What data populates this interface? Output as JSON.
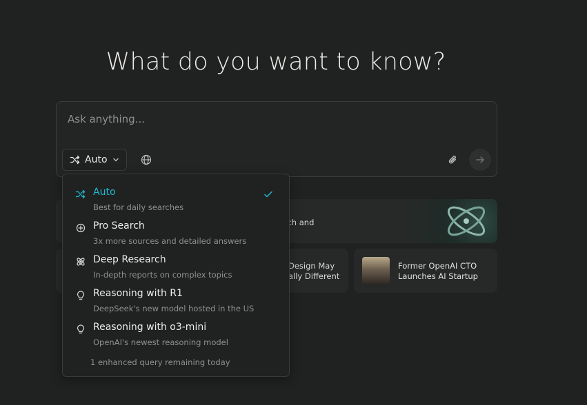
{
  "heading": "What do you want to know?",
  "search": {
    "placeholder": "Ask anything...",
    "mode_label": "Auto"
  },
  "cards": {
    "wide_text": "rch and",
    "middle_line1": "Design May",
    "middle_line2": "ally Different",
    "right_line1": "Former OpenAI CTO",
    "right_line2": "Launches AI Startup"
  },
  "dropdown": {
    "options": [
      {
        "label": "Auto",
        "desc": "Best for daily searches",
        "selected": true,
        "icon": "shuffle-icon"
      },
      {
        "label": "Pro Search",
        "desc": "3x more sources and detailed answers",
        "icon": "pro-search-icon"
      },
      {
        "label": "Deep Research",
        "desc": "In-depth reports on complex topics",
        "icon": "atom-icon"
      },
      {
        "label": "Reasoning with R1",
        "desc": "DeepSeek's new model hosted in the US",
        "icon": "lightbulb-icon"
      },
      {
        "label": "Reasoning with o3-mini",
        "desc": "OpenAI's newest reasoning model",
        "icon": "lightbulb-icon"
      }
    ],
    "footer": "1 enhanced query remaining today"
  },
  "colors": {
    "background": "#202121",
    "accent": "#20b8cd",
    "border": "#3a3c3c"
  }
}
